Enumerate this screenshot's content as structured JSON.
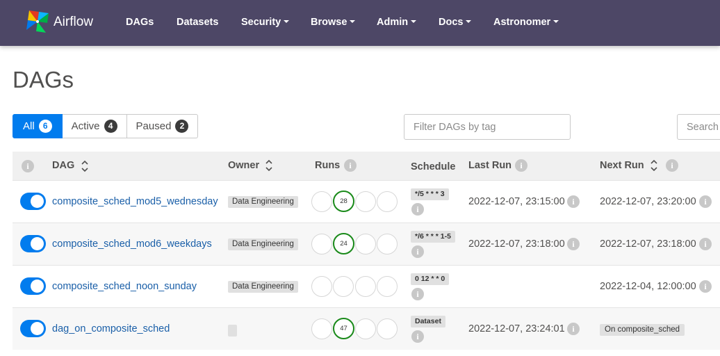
{
  "navbar": {
    "brand": "Airflow",
    "items": [
      {
        "label": "DAGs",
        "dropdown": false
      },
      {
        "label": "Datasets",
        "dropdown": false
      },
      {
        "label": "Security",
        "dropdown": true
      },
      {
        "label": "Browse",
        "dropdown": true
      },
      {
        "label": "Admin",
        "dropdown": true
      },
      {
        "label": "Docs",
        "dropdown": true
      },
      {
        "label": "Astronomer",
        "dropdown": true
      }
    ]
  },
  "page": {
    "title": "DAGs"
  },
  "status_filter": {
    "all": {
      "label": "All",
      "count": "6"
    },
    "active": {
      "label": "Active",
      "count": "4"
    },
    "paused": {
      "label": "Paused",
      "count": "2"
    }
  },
  "tag_filter": {
    "placeholder": "Filter DAGs by tag",
    "value": ""
  },
  "search": {
    "placeholder": "Search DAGs",
    "value": ""
  },
  "table": {
    "headers": {
      "dag": "DAG",
      "owner": "Owner",
      "runs": "Runs",
      "schedule": "Schedule",
      "last_run": "Last Run",
      "next_run": "Next Run"
    },
    "rows": [
      {
        "dag_id": "composite_sched_mod5_wednesday",
        "owner": "Data Engineering",
        "runs_success": "28",
        "schedule": "*/5 * * * 3",
        "last_run": "2022-12-07, 23:15:00",
        "next_run": "2022-12-07, 23:20:00"
      },
      {
        "dag_id": "composite_sched_mod6_weekdays",
        "owner": "Data Engineering",
        "runs_success": "24",
        "schedule": "*/6 * * * 1-5",
        "last_run": "2022-12-07, 23:18:00",
        "next_run": "2022-12-07, 23:18:00"
      },
      {
        "dag_id": "composite_sched_noon_sunday",
        "owner": "Data Engineering",
        "runs_success": "",
        "schedule": "0 12 * * 0",
        "last_run": "",
        "next_run": "2022-12-04, 12:00:00"
      },
      {
        "dag_id": "dag_on_composite_sched",
        "owner": "",
        "runs_success": "47",
        "schedule": "Dataset",
        "last_run": "2022-12-07, 23:24:01",
        "next_run": "On composite_sched"
      }
    ]
  },
  "colors": {
    "navbar_bg": "#4d4766",
    "accent": "#017cee",
    "success": "#1a8a1a",
    "badge_bg": "#e0e0e0"
  },
  "icons": [
    "pinwheel-logo",
    "info-icon",
    "sort-icon",
    "dropdown-caret-icon"
  ]
}
